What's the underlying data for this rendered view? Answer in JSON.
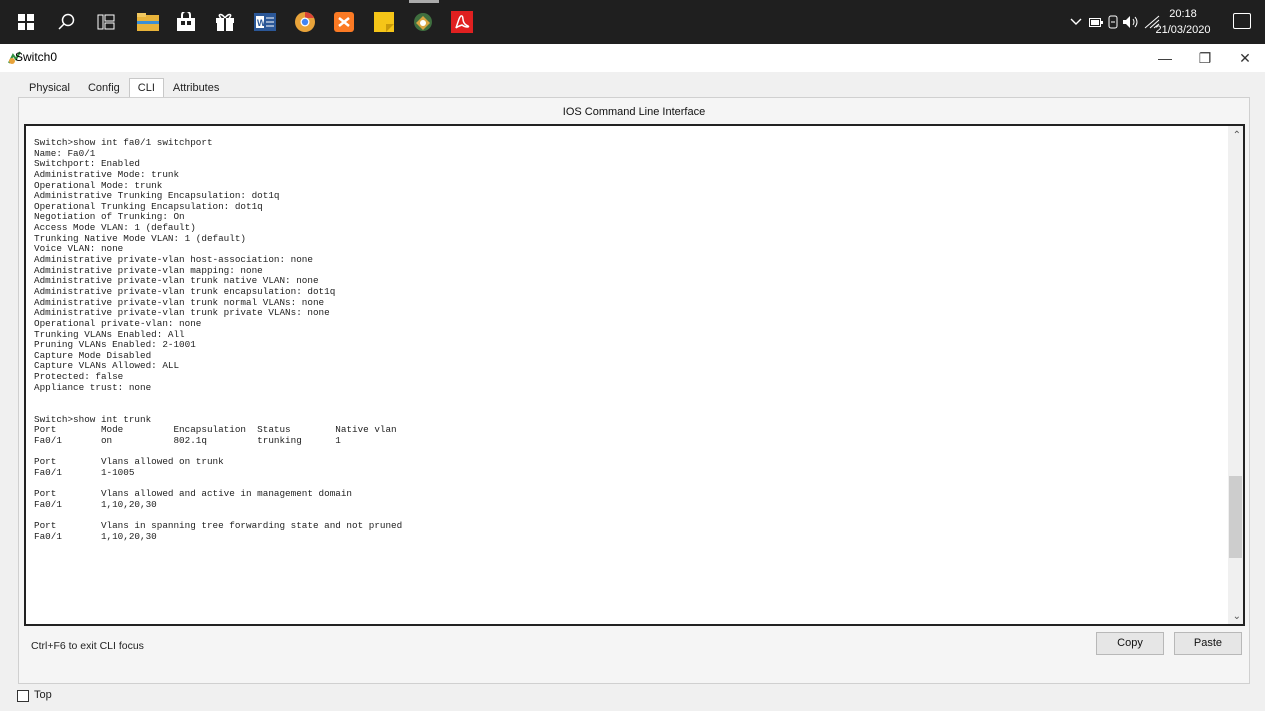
{
  "window": {
    "title": "Switch0"
  },
  "taskbar": {
    "clock_time": "20:18",
    "clock_date": "21/03/2020",
    "icons": [
      "windows-start-icon",
      "search-icon",
      "task-view-icon",
      "file-explorer-icon",
      "store-icon",
      "gift-icon",
      "word-icon",
      "chrome-icon",
      "xampp-icon",
      "sticky-notes-icon",
      "packet-tracer-icon",
      "pdf-reader-icon"
    ],
    "tray": [
      "chevron-up-icon",
      "battery-icon",
      "network-icon",
      "volume-icon",
      "wifi-icon"
    ]
  },
  "tabs": [
    {
      "label": "Physical"
    },
    {
      "label": "Config"
    },
    {
      "label": "CLI"
    },
    {
      "label": "Attributes"
    }
  ],
  "active_tab": "CLI",
  "cli": {
    "header": "IOS Command Line Interface",
    "lines": [
      "Switch>show int fa0/1 switchport",
      "Name: Fa0/1",
      "Switchport: Enabled",
      "Administrative Mode: trunk",
      "Operational Mode: trunk",
      "Administrative Trunking Encapsulation: dot1q",
      "Operational Trunking Encapsulation: dot1q",
      "Negotiation of Trunking: On",
      "Access Mode VLAN: 1 (default)",
      "Trunking Native Mode VLAN: 1 (default)",
      "Voice VLAN: none",
      "Administrative private-vlan host-association: none",
      "Administrative private-vlan mapping: none",
      "Administrative private-vlan trunk native VLAN: none",
      "Administrative private-vlan trunk encapsulation: dot1q",
      "Administrative private-vlan trunk normal VLANs: none",
      "Administrative private-vlan trunk private VLANs: none",
      "Operational private-vlan: none",
      "Trunking VLANs Enabled: All",
      "Pruning VLANs Enabled: 2-1001",
      "Capture Mode Disabled",
      "Capture VLANs Allowed: ALL",
      "Protected: false",
      "Appliance trust: none",
      "",
      "",
      "Switch>show int trunk",
      "Port        Mode         Encapsulation  Status        Native vlan",
      "Fa0/1       on           802.1q         trunking      1",
      "",
      "Port        Vlans allowed on trunk",
      "Fa0/1       1-1005",
      "",
      "Port        Vlans allowed and active in management domain",
      "Fa0/1       1,10,20,30",
      "",
      "Port        Vlans in spanning tree forwarding state and not pruned",
      "Fa0/1       1,10,20,30"
    ],
    "hint": "Ctrl+F6 to exit CLI focus",
    "copy_label": "Copy",
    "paste_label": "Paste"
  },
  "footer": {
    "top_label": "Top",
    "top_checked": false
  }
}
